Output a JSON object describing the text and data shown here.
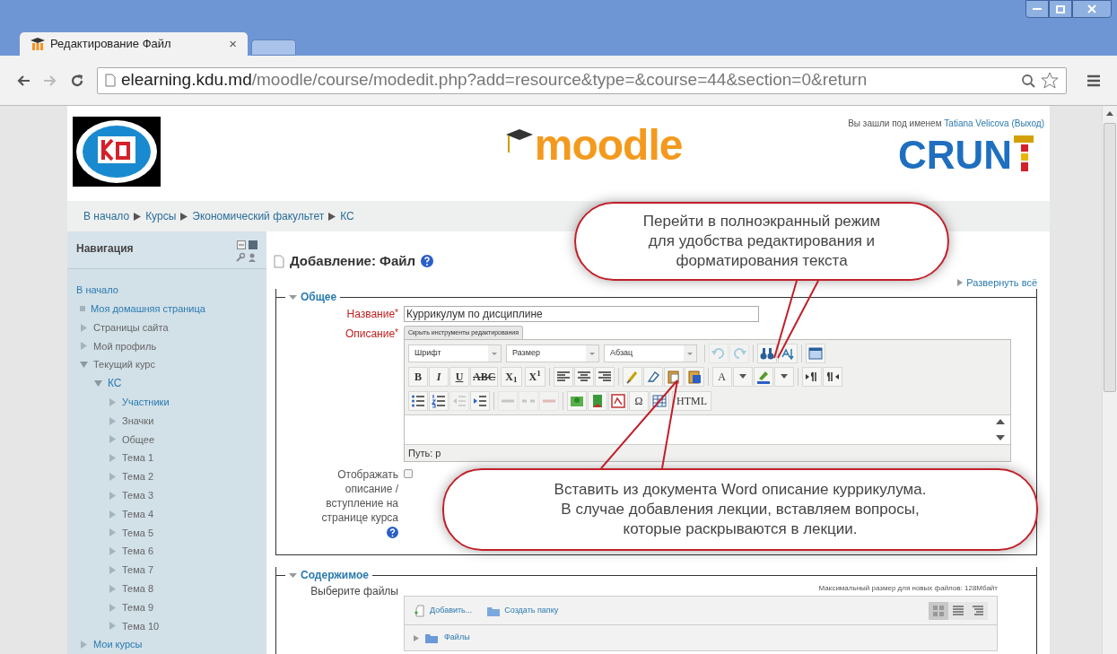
{
  "browser": {
    "tab_title": "Редактирование Файл",
    "tab_close": "×",
    "url_host": "elearning.kdu.md",
    "url_path": "/moodle/course/modedit.php?add=resource&type=&course=44&section=0&return"
  },
  "header": {
    "login_prefix": "Вы зашли под именем",
    "user": "Tatiana Velicova",
    "logout": "(Выход)",
    "moodle_logo": "moodle",
    "crun_logo": "CRUN"
  },
  "breadcrumb": [
    "В начало",
    "Курсы",
    "Экономический факультет",
    "КС"
  ],
  "navigation": {
    "title": "Навигация",
    "items": [
      {
        "label": "В начало",
        "kind": "plain",
        "link": true,
        "children": [
          {
            "label": "Моя домашняя страница",
            "kind": "leaf",
            "link": true
          },
          {
            "label": "Страницы сайта",
            "kind": "branch",
            "link": false,
            "expanded": false
          },
          {
            "label": "Мой профиль",
            "kind": "branch",
            "link": false,
            "expanded": false
          },
          {
            "label": "Текущий курс",
            "kind": "branch",
            "link": false,
            "expanded": true,
            "children": [
              {
                "label": "КС",
                "kind": "branch",
                "link": true,
                "expanded": true,
                "children": [
                  {
                    "label": "Участники",
                    "kind": "branch",
                    "link": true,
                    "expanded": false
                  },
                  {
                    "label": "Значки",
                    "kind": "branch",
                    "link": false,
                    "expanded": false
                  },
                  {
                    "label": "Общее",
                    "kind": "branch",
                    "link": false,
                    "expanded": false
                  },
                  {
                    "label": "Тема 1",
                    "kind": "branch",
                    "link": false,
                    "expanded": false
                  },
                  {
                    "label": "Тема 2",
                    "kind": "branch",
                    "link": false,
                    "expanded": false
                  },
                  {
                    "label": "Тема 3",
                    "kind": "branch",
                    "link": false,
                    "expanded": false
                  },
                  {
                    "label": "Тема 4",
                    "kind": "branch",
                    "link": false,
                    "expanded": false
                  },
                  {
                    "label": "Тема 5",
                    "kind": "branch",
                    "link": false,
                    "expanded": false
                  },
                  {
                    "label": "Тема 6",
                    "kind": "branch",
                    "link": false,
                    "expanded": false
                  },
                  {
                    "label": "Тема 7",
                    "kind": "branch",
                    "link": false,
                    "expanded": false
                  },
                  {
                    "label": "Тема 8",
                    "kind": "branch",
                    "link": false,
                    "expanded": false
                  },
                  {
                    "label": "Тема 9",
                    "kind": "branch",
                    "link": false,
                    "expanded": false
                  },
                  {
                    "label": "Тема 10",
                    "kind": "branch",
                    "link": false,
                    "expanded": false
                  }
                ]
              }
            ]
          },
          {
            "label": "Мои курсы",
            "kind": "branch",
            "link": true,
            "expanded": false
          }
        ]
      }
    ]
  },
  "page": {
    "title": "Добавление: Файл",
    "expand_all": "Развернуть всё"
  },
  "general": {
    "legend": "Общее",
    "expanded": true,
    "name": {
      "label": "Название",
      "mark": "*",
      "value": "Куррикулум по дисциплине"
    },
    "description": {
      "label": "Описание",
      "mark": "*",
      "hide_tools": "Скрыть инструменты редактирования",
      "path": "Путь: p",
      "toolbar": [
        [
          {
            "kind": "select",
            "label": "Шрифт"
          },
          {
            "kind": "select",
            "label": "Размер"
          },
          {
            "kind": "select",
            "label": "Абзац"
          },
          {
            "kind": "sep"
          },
          {
            "kind": "icon",
            "disabled": true
          },
          {
            "kind": "icon",
            "disabled": true
          },
          {
            "kind": "sep"
          },
          {
            "kind": "icon",
            "disabled": false
          },
          {
            "kind": "icon",
            "disabled": false
          },
          {
            "kind": "sep"
          },
          {
            "kind": "icon",
            "disabled": false
          }
        ],
        [
          {
            "kind": "glyph",
            "label": "B",
            "disabled": false
          },
          {
            "kind": "glyph",
            "label": "I",
            "disabled": false
          },
          {
            "kind": "glyph",
            "label": "U",
            "disabled": false
          },
          {
            "kind": "glyph",
            "label": "ABC",
            "disabled": false
          },
          {
            "kind": "glyph",
            "label": "X$_{1}$",
            "disabled": false
          },
          {
            "kind": "glyph",
            "label": "X$^{1}$",
            "disabled": false
          },
          {
            "kind": "sep"
          },
          {
            "kind": "icon",
            "disabled": false
          },
          {
            "kind": "icon",
            "disabled": false
          },
          {
            "kind": "icon",
            "disabled": false
          },
          {
            "kind": "sep"
          },
          {
            "kind": "icon",
            "disabled": false
          },
          {
            "kind": "icon",
            "disabled": false
          },
          {
            "kind": "icon",
            "disabled": false
          },
          {
            "kind": "icon",
            "disabled": false
          },
          {
            "kind": "sep"
          },
          {
            "kind": "glyph",
            "label": "A",
            "disabled": false
          },
          {
            "kind": "icon",
            "disabled": false
          },
          {
            "kind": "icon",
            "disabled": false
          },
          {
            "kind": "icon",
            "disabled": false
          },
          {
            "kind": "sep"
          },
          {
            "kind": "icon",
            "disabled": false
          },
          {
            "kind": "icon",
            "disabled": false
          }
        ],
        [
          {
            "kind": "icon",
            "disabled": false
          },
          {
            "kind": "icon",
            "disabled": false
          },
          {
            "kind": "icon",
            "disabled": true
          },
          {
            "kind": "icon",
            "disabled": false
          },
          {
            "kind": "sep"
          },
          {
            "kind": "icon",
            "disabled": true
          },
          {
            "kind": "icon",
            "disabled": true
          },
          {
            "kind": "icon",
            "disabled": true
          },
          {
            "kind": "sep"
          },
          {
            "kind": "icon",
            "disabled": false
          },
          {
            "kind": "icon",
            "disabled": false
          },
          {
            "kind": "icon",
            "disabled": false
          },
          {
            "kind": "glyph",
            "label": "Ω",
            "disabled": false
          },
          {
            "kind": "icon",
            "disabled": false
          },
          {
            "kind": "glyph",
            "label": "HTML",
            "disabled": false
          }
        ]
      ]
    },
    "show_description": {
      "label": "Отображать описание / вступление на странице курса",
      "checked": false
    }
  },
  "content": {
    "legend": "Содержимое",
    "expanded": true,
    "files_label": "Выберите файлы",
    "max_size": "Максимальный размер для новых файлов: 128Мбайт",
    "add": "Добавить...",
    "create_folder": "Создать папку",
    "views": [
      {
        "selected": true
      },
      {
        "selected": false
      },
      {
        "selected": false
      }
    ],
    "folder": "Файлы"
  },
  "callouts": [
    {
      "text": "Перейти в полноэкранный режим\nдля удобства редактирования и\nформатирования текста"
    },
    {
      "text": "Вставить из документа Word описание куррикулума.\nВ случае добавления лекции, вставляем вопросы,\nкоторые раскрываются в лекции."
    }
  ]
}
